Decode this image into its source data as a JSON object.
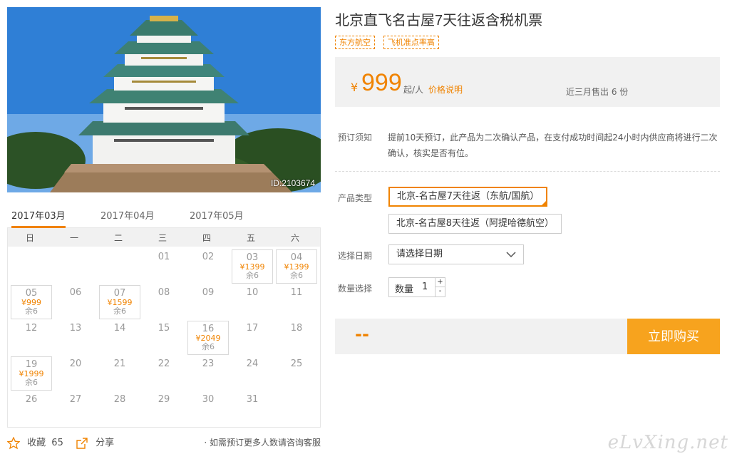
{
  "photo": {
    "id_label": "ID:2103674"
  },
  "calendar": {
    "months": [
      "2017年03月",
      "2017年04月",
      "2017年05月"
    ],
    "weekdays": [
      "日",
      "一",
      "二",
      "三",
      "四",
      "五",
      "六"
    ],
    "rows": [
      [
        {
          "d": ""
        },
        {
          "d": ""
        },
        {
          "d": ""
        },
        {
          "d": "01"
        },
        {
          "d": "02"
        },
        {
          "d": "03",
          "price": "¥1399",
          "remain": "余6"
        },
        {
          "d": "04",
          "price": "¥1399",
          "remain": "余6"
        }
      ],
      [
        {
          "d": "05",
          "price": "¥999",
          "remain": "余6"
        },
        {
          "d": "06"
        },
        {
          "d": "07",
          "price": "¥1599",
          "remain": "余6"
        },
        {
          "d": "08"
        },
        {
          "d": "09"
        },
        {
          "d": "10"
        },
        {
          "d": "11"
        }
      ],
      [
        {
          "d": "12"
        },
        {
          "d": "13"
        },
        {
          "d": "14"
        },
        {
          "d": "15"
        },
        {
          "d": "16",
          "price": "¥2049",
          "remain": "余6"
        },
        {
          "d": "17"
        },
        {
          "d": "18"
        }
      ],
      [
        {
          "d": "19",
          "price": "¥1999",
          "remain": "余6"
        },
        {
          "d": "20"
        },
        {
          "d": "21"
        },
        {
          "d": "22"
        },
        {
          "d": "23"
        },
        {
          "d": "24"
        },
        {
          "d": "25"
        }
      ],
      [
        {
          "d": "26"
        },
        {
          "d": "27"
        },
        {
          "d": "28"
        },
        {
          "d": "29"
        },
        {
          "d": "30"
        },
        {
          "d": "31"
        },
        {
          "d": ""
        }
      ]
    ]
  },
  "footer": {
    "favorite_label": "收藏",
    "favorite_count": "65",
    "share_label": "分享",
    "note": "如需预订更多人数请咨询客服"
  },
  "product": {
    "title": "北京直飞名古屋7天往返含税机票",
    "tags": [
      "东方航空",
      "飞机准点率高"
    ],
    "currency": "¥",
    "price": "999",
    "unit": "起/人",
    "price_explain": "价格说明",
    "sold": "近三月售出 6 份"
  },
  "booking": {
    "notice_label": "预订须知",
    "notice_text": "提前10天预订，此产品为二次确认产品，在支付成功时间起24小时内供应商将进行二次确认，核实是否有位。",
    "type_label": "产品类型",
    "options": [
      "北京-名古屋7天往返（东航/国航）",
      "北京-名古屋8天往返（阿提哈德航空）"
    ],
    "date_label": "选择日期",
    "date_placeholder": "请选择日期",
    "qty_label": "数量选择",
    "qty_inner_label": "数量",
    "qty_value": "1",
    "qty_plus": "+",
    "qty_minus": "-",
    "total": "--",
    "buy_label": "立即购买"
  },
  "watermark": "eLvXing.net",
  "colors": {
    "accent": "#f08300",
    "buy_button": "#f7a31e"
  }
}
